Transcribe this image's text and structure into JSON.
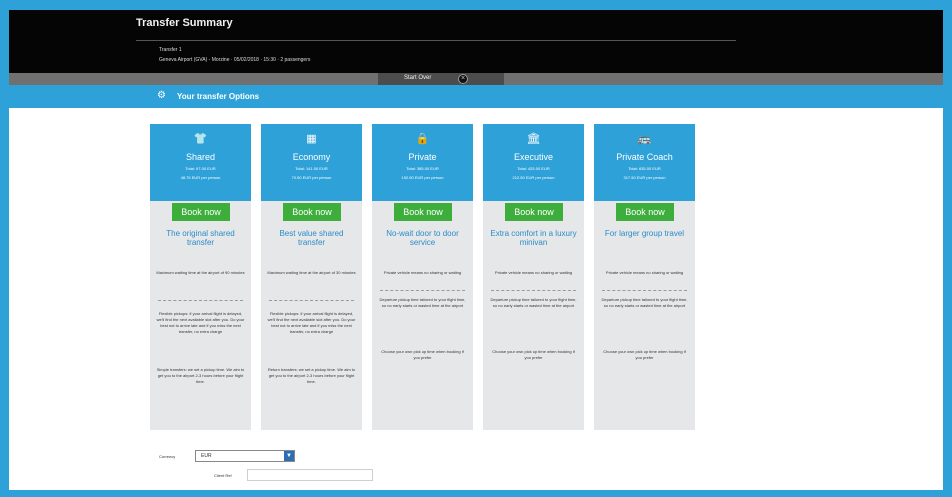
{
  "header": {
    "title": "Transfer Summary",
    "transfer_label": "Transfer 1",
    "transfer_details": "Geneva Airport (GVA) - Morzine · 05/02/2018 · 15:30 · 2 passengers"
  },
  "start_over": {
    "label": "Start Over",
    "icon": "close-icon"
  },
  "options": {
    "title": "Your transfer Options",
    "icon": "gear-icon"
  },
  "cards": [
    {
      "icon": "shirt-icon",
      "name": "Shared",
      "price": "Total: 97.00 EUR",
      "per_person": "48.75 EUR per person",
      "book_label": "Book now",
      "tagline": "The original shared transfer",
      "info": "Maximum waiting time at the airport of 90 minutes",
      "pickup": "Flexible pickups: if your arrival flight is delayed, we'll find the next available slot after you. Do your best not to arrive late and if you miss the next transfer, no extra charge",
      "return": "Simple transfers: we set a pickup time. We aim to get you to the airport 2-3 hours before your flight time."
    },
    {
      "icon": "building-icon",
      "name": "Economy",
      "price": "Total: 141.00 EUR",
      "per_person": "70.50 EUR per person",
      "book_label": "Book now",
      "tagline": "Best value shared transfer",
      "info": "Maximum waiting time at the airport of 30 minutes",
      "pickup": "Flexible pickups: if your arrival flight is delayed, we'll find the next available slot after you. Do your best not to arrive late and if you miss the next transfer, no extra charge",
      "return": "Return transfers: we set a pickup time. We aim to get you to the airport 2-3 hours before your flight time."
    },
    {
      "icon": "lock-icon",
      "name": "Private",
      "price": "Total: 385.00 EUR",
      "per_person": "192.50 EUR per person",
      "book_label": "Book now",
      "tagline": "No-wait door to door service",
      "info": "Private vehicle means no sharing or waiting",
      "pickup": "Departure pickup time tailored to your flight time, so no early starts or wasted time at the airport",
      "return": "Choose your own pick up time when booking if you prefer"
    },
    {
      "icon": "bank-icon",
      "name": "Executive",
      "price": "Total: 425.00 EUR",
      "per_person": "212.50 EUR per person",
      "book_label": "Book now",
      "tagline": "Extra comfort in a luxury minivan",
      "info": "Private vehicle means no sharing or waiting",
      "pickup": "Departure pickup time tailored to your flight time, so no early starts or wasted time at the airport",
      "return": "Choose your own pick up time when booking if you prefer"
    },
    {
      "icon": "coach-icon",
      "name": "Private Coach",
      "price": "Total: 635.00 EUR",
      "per_person": "317.50 EUR per person",
      "book_label": "Book now",
      "tagline": "For larger group travel",
      "info": "Private vehicle means no sharing or waiting",
      "pickup": "Departure pickup time tailored to your flight time, so no early starts or wasted time at the airport",
      "return": "Choose your own pick up time when booking if you prefer"
    }
  ],
  "form": {
    "currency_label": "Currency",
    "currency_value": "EUR",
    "client_ref_label": "Client Ref",
    "client_ref_value": ""
  }
}
